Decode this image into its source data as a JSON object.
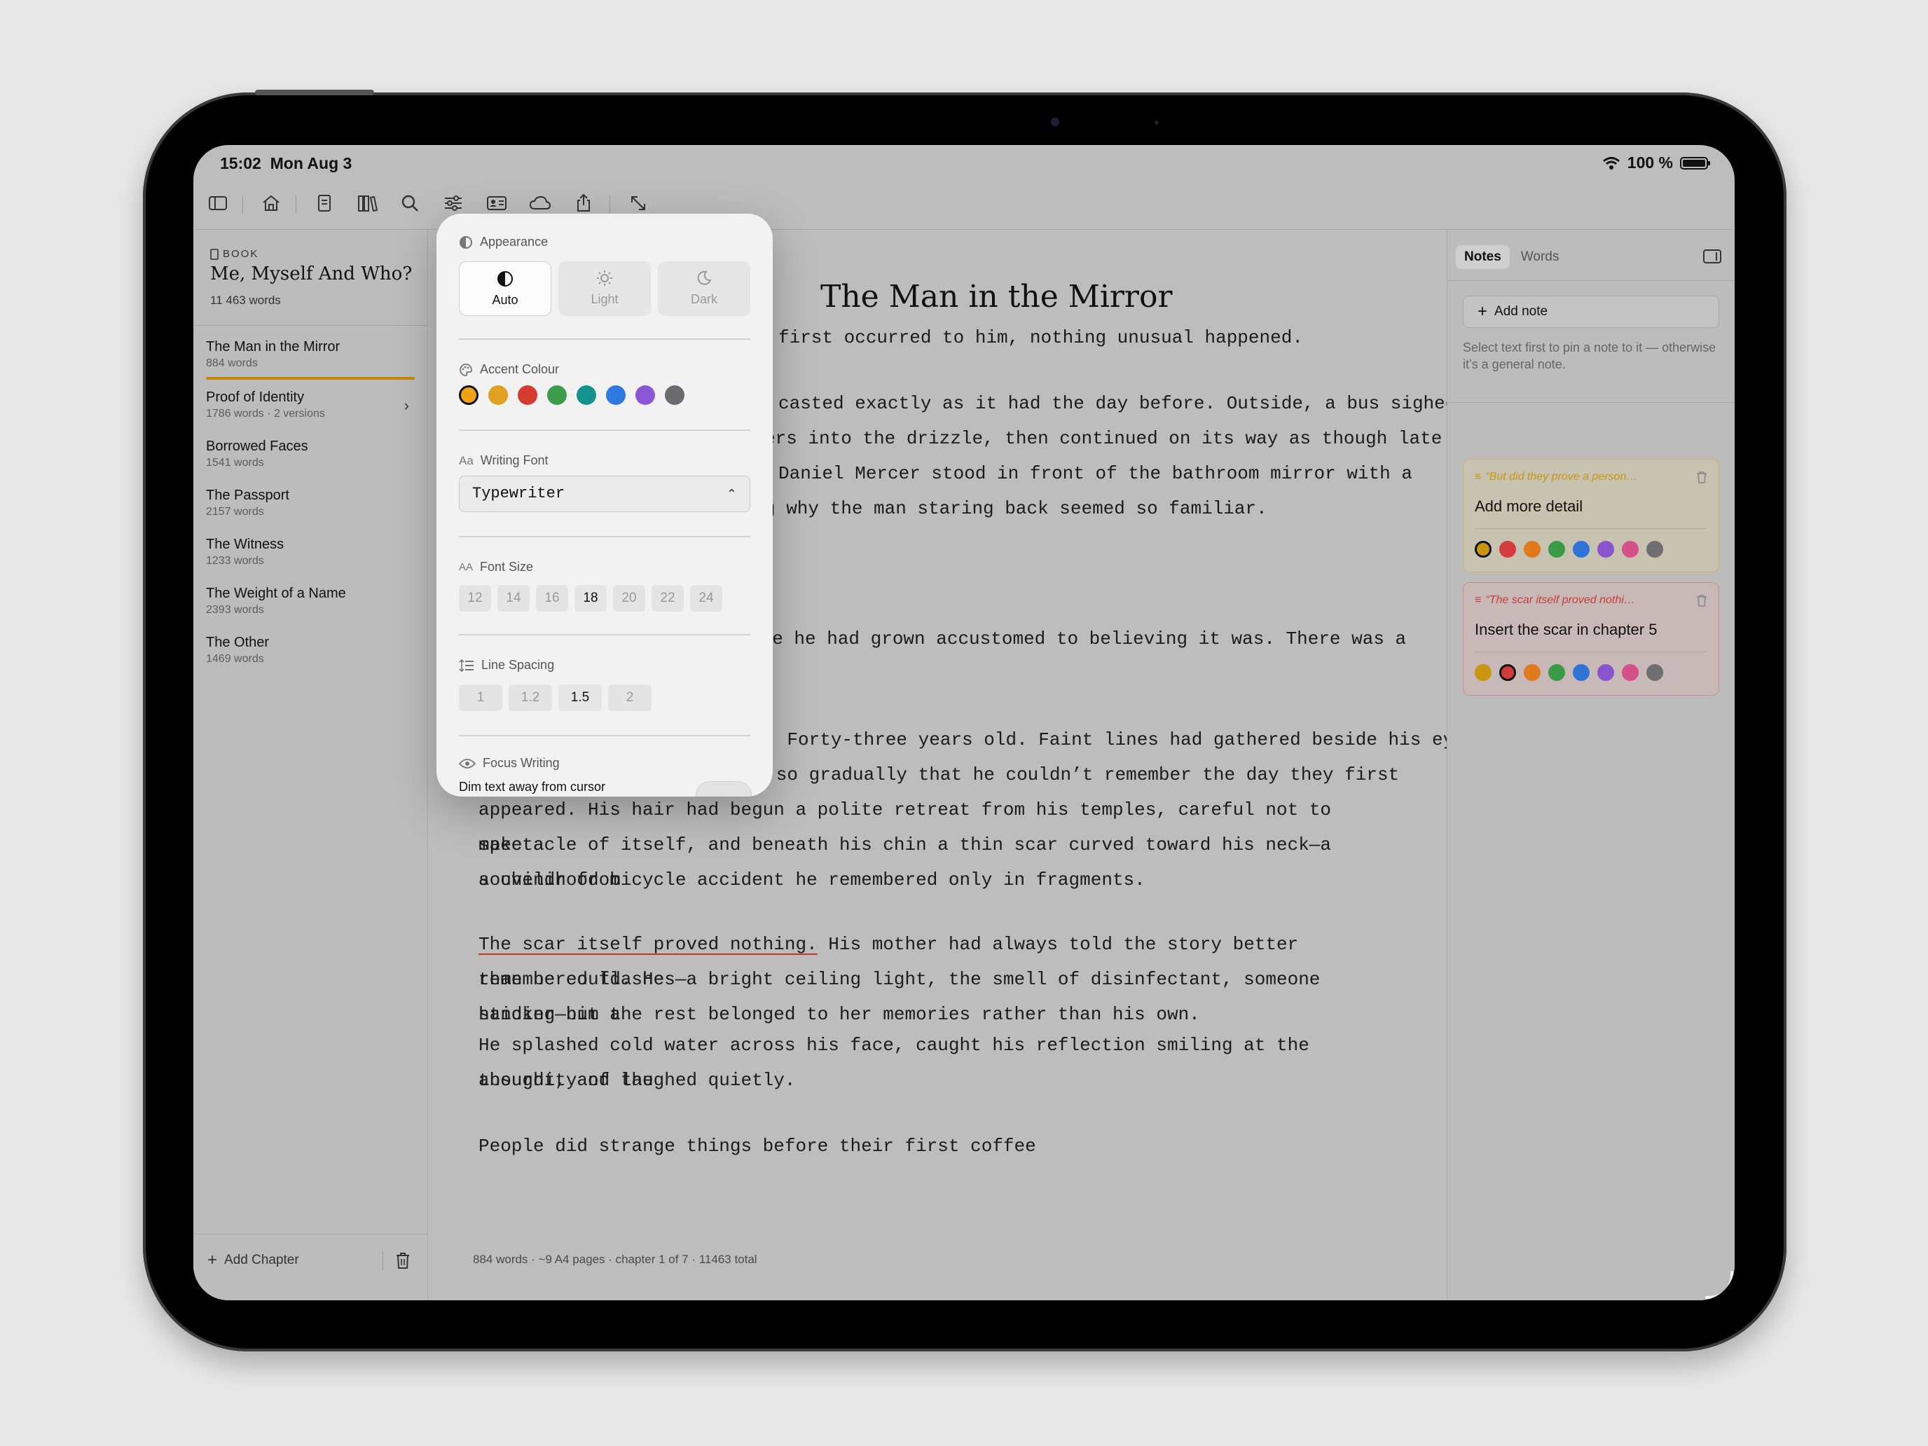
{
  "status": {
    "time": "15:02",
    "date": "Mon Aug 3",
    "battery": "100 %"
  },
  "toolbar": {
    "icons": [
      "sidebar-toggle-icon",
      "home-icon",
      "document-icon",
      "library-icon",
      "search-icon",
      "sliders-icon",
      "id-card-icon",
      "cloud-icon",
      "share-icon",
      "expand-icon"
    ]
  },
  "sidebar": {
    "kicker": "BOOK",
    "book_title": "Me, Myself And Who?",
    "book_words": "11 463 words",
    "chapters": [
      {
        "title": "The Man in the Mirror",
        "meta": "884 words",
        "active": true
      },
      {
        "title": "Proof of Identity",
        "meta": "1786 words · 2 versions",
        "has_chevron": true
      },
      {
        "title": "Borrowed Faces",
        "meta": "1541 words"
      },
      {
        "title": "The Passport",
        "meta": "2157 words"
      },
      {
        "title": "The Witness",
        "meta": "1233 words"
      },
      {
        "title": "The Weight of a Name",
        "meta": "2393 words"
      },
      {
        "title": "The Other",
        "meta": "1469 words"
      }
    ],
    "add_chapter": "Add Chapter"
  },
  "editor": {
    "chapter_title": "The Man in the Mirror",
    "paragraphs": [
      [
        "first occurred to him, nothing unusual happened."
      ],
      [
        "casted exactly as it had the day before. Outside, a bus sighed to a",
        "ers into the drizzle, then continued on its way as though late for",
        "Daniel Mercer stood in front of the bathroom mirror with a",
        "g why the man staring back seemed so familiar."
      ],
      [
        "use he had grown accustomed to believing it was. There was a"
      ],
      [
        "or. Forty-three years old. Faint lines had gathered beside his eyes",
        "ng so gradually that he couldn’t remember the day they first",
        "appeared. His hair had begun a polite retreat from his temples, careful not to make a",
        "spectacle of itself, and beneath his chin a thin scar curved toward his neck—a souvenir from",
        "a childhood bicycle accident he remembered only in fragments."
      ],
      [
        "His mother had always told the story better than he could. He",
        "remembered flashes—a bright ceiling light, the smell of disinfectant, someone handing him a",
        "sticker—but the rest belonged to her memories rather than his own."
      ],
      [
        "He splashed cold water across his face, caught his reflection smiling at the absurdity of the",
        "thought, and laughed quietly."
      ],
      [
        "People did strange things before their first coffee"
      ]
    ],
    "underlined_phrase": "The scar itself proved nothing.",
    "footer": "884 words · ~9 A4 pages · chapter 1 of 7 · 11463 total"
  },
  "notes_panel": {
    "tabs": [
      "Notes",
      "Words"
    ],
    "active_tab": "Notes",
    "add_note": "Add note",
    "hint": "Select text first to pin a note to it — otherwise it’s a general note.",
    "notes": [
      {
        "quote": "“But did they prove a person…",
        "text": "Add more detail",
        "color": "#c8960f",
        "selected_index": 0
      },
      {
        "quote": "“The scar itself proved nothi…",
        "text": "Insert the scar in chapter 5",
        "color": "#cc3a3a",
        "selected_index": 1
      }
    ],
    "dot_colors": [
      "#c8960f",
      "#d23c3c",
      "#e07a1c",
      "#3a9a45",
      "#2f74d6",
      "#8a55cc",
      "#d6508a",
      "#6e6e73"
    ]
  },
  "appearance": {
    "title": "Appearance",
    "modes": [
      {
        "label": "Auto",
        "icon": "half-circle-icon",
        "active": true
      },
      {
        "label": "Light",
        "icon": "sun-icon",
        "active": false
      },
      {
        "label": "Dark",
        "icon": "moon-icon",
        "active": false
      }
    ],
    "accent_label": "Accent Colour",
    "accent_colors": [
      "#f0a316",
      "#e0a020",
      "#d63b30",
      "#3d9c4a",
      "#17938f",
      "#2f7ae0",
      "#8a58d6",
      "#6b6b70"
    ],
    "accent_selected": 0,
    "font_label": "Writing Font",
    "font_value": "Typewriter",
    "font_size_label": "Font Size",
    "font_sizes": [
      "12",
      "14",
      "16",
      "18",
      "20",
      "22",
      "24"
    ],
    "font_size_selected": "18",
    "line_spacing_label": "Line Spacing",
    "line_spacings": [
      "1",
      "1.2",
      "1.5",
      "2"
    ],
    "line_spacing_selected": "1.5",
    "focus_label": "Focus Writing",
    "focus_desc": "Dim text away from cursor",
    "focus_on": false
  }
}
